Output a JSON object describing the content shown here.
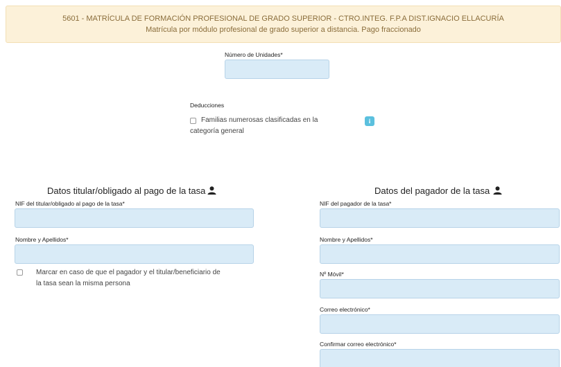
{
  "banner": {
    "line1": "5601  -  MATRÍCULA DE FORMACIÓN PROFESIONAL DE GRADO SUPERIOR  -  CTRO.INTEG. F.P.A DIST.IGNACIO ELLACURÍA",
    "line2": "Matrícula por módulo profesional de grado superior a distancia. Pago fraccionado"
  },
  "units": {
    "label": "Número de Unidades*",
    "value": ""
  },
  "deductions": {
    "label": "Deducciones",
    "option_line1": "Familias numerosas clasificadas en la",
    "option_line2": "categoría general",
    "info_icon": "i"
  },
  "holder": {
    "title": "Datos titular/obligado al pago de la tasa",
    "nif_label": "NIF del titular/obligado al pago de la tasa*",
    "nif_value": "",
    "name_label": "Nombre y Apellidos*",
    "name_value": "",
    "same_person_line1": "Marcar en caso de que el pagador y el titular/beneficiario de",
    "same_person_line2": "la tasa sean la misma persona"
  },
  "payer": {
    "title": "Datos del pagador de la tasa",
    "nif_label": "NIF del pagador de la tasa*",
    "nif_value": "",
    "name_label": "Nombre y Apellidos*",
    "name_value": "",
    "mobile_label": "Nº Móvil*",
    "mobile_value": "",
    "email_label": "Correo electrónico*",
    "email_value": "",
    "email_confirm_label": "Confirmar correo electrónico*",
    "email_confirm_value": ""
  },
  "icons": {
    "person": "person-icon",
    "info": "info-icon"
  },
  "colors": {
    "banner_bg": "#fcf1d9",
    "banner_text": "#8a6d3b",
    "input_bg": "#d9ebf7",
    "info_button": "#5bc0de"
  }
}
